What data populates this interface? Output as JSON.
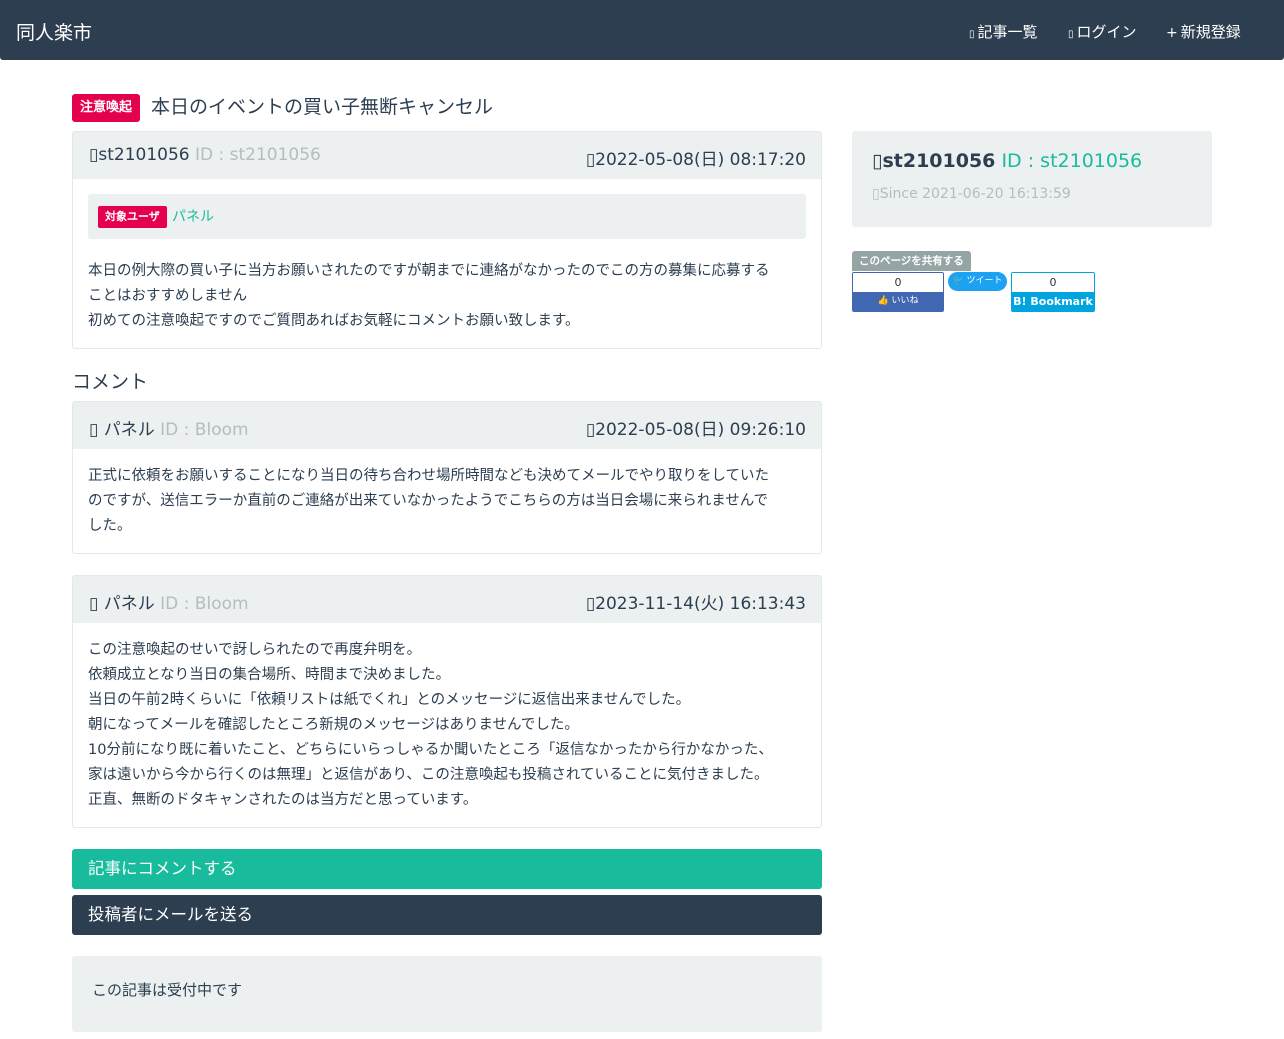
{
  "navbar": {
    "brand": "同人楽市",
    "items": [
      {
        "icon": "list-icon",
        "glyph": "▯",
        "label": "記事一覧"
      },
      {
        "icon": "login-icon",
        "glyph": "▯",
        "label": "ログイン"
      },
      {
        "icon": "plus-icon",
        "glyph": "+",
        "label": "新規登録"
      }
    ]
  },
  "article": {
    "badge": "注意喚起",
    "title": "本日のイベントの買い子無断キャンセル",
    "author_icon_glyph": "▯",
    "author": "st2101056",
    "author_id": "ID : st2101056",
    "date_icon_glyph": "▯",
    "date": "2022-05-08(日) 08:17:20",
    "target_badge": "対象ユーザ",
    "target_user": "パネル",
    "body": [
      "本日の例大際の買い子に当方お願いされたのですが朝までに連絡がなかったのでこの方の募集に応募する",
      "ことはおすすめしません",
      "初めての注意喚起ですのでご質問あればお気軽にコメントお願い致します。"
    ]
  },
  "comments_heading": "コメント",
  "comments": [
    {
      "author_icon_glyph": "▯",
      "author": "パネル",
      "author_id": "ID : Bloom",
      "date_icon_glyph": "▯",
      "date": "2022-05-08(日) 09:26:10",
      "body": [
        "正式に依頼をお願いすることになり当日の待ち合わせ場所時間なども決めてメールでやり取りをしていた",
        "のですが、送信エラーか直前のご連絡が出来ていなかったようでこちらの方は当日会場に来られませんで",
        "した。"
      ]
    },
    {
      "author_icon_glyph": "▯",
      "author": "パネル",
      "author_id": "ID : Bloom",
      "date_icon_glyph": "▯",
      "date": "2023-11-14(火) 16:13:43",
      "body": [
        "この注意喚起のせいで訝しられたので再度弁明を。",
        "依頼成立となり当日の集合場所、時間まで決めました。",
        "当日の午前2時くらいに「依頼リストは紙でくれ」とのメッセージに返信出来ませんでした。",
        "朝になってメールを確認したところ新規のメッセージはありませんでした。",
        "10分前になり既に着いたこと、どちらにいらっしゃるか聞いたところ「返信なかったから行かなかった、",
        "家は遠いから今から行くのは無理」と返信があり、この注意喚起も投稿されていることに気付きました。",
        "正直、無断のドタキャンされたのは当方だと思っています。"
      ]
    }
  ],
  "actions": {
    "comment_button": "記事にコメントする",
    "mail_button": "投稿者にメールを送る"
  },
  "status_text": "この記事は受付中です",
  "profile": {
    "icon_glyph": "▯",
    "name": "st2101056",
    "id": "ID : st2101056",
    "since_icon_glyph": "▯",
    "since": "Since 2021-06-20 16:13:59"
  },
  "share": {
    "label": "このページを共有する",
    "facebook_count": "0",
    "facebook_label": "👍 いいね",
    "twitter_label": "🐦 ツイート",
    "hatena_count": "0",
    "hatena_label": "B! Bookmark"
  },
  "colors": {
    "navbar": "#2c3e50",
    "accent": "#18bc9c",
    "danger_badge": "#e5004f",
    "panel": "#ecf0f1",
    "muted": "#b4bcc2"
  }
}
